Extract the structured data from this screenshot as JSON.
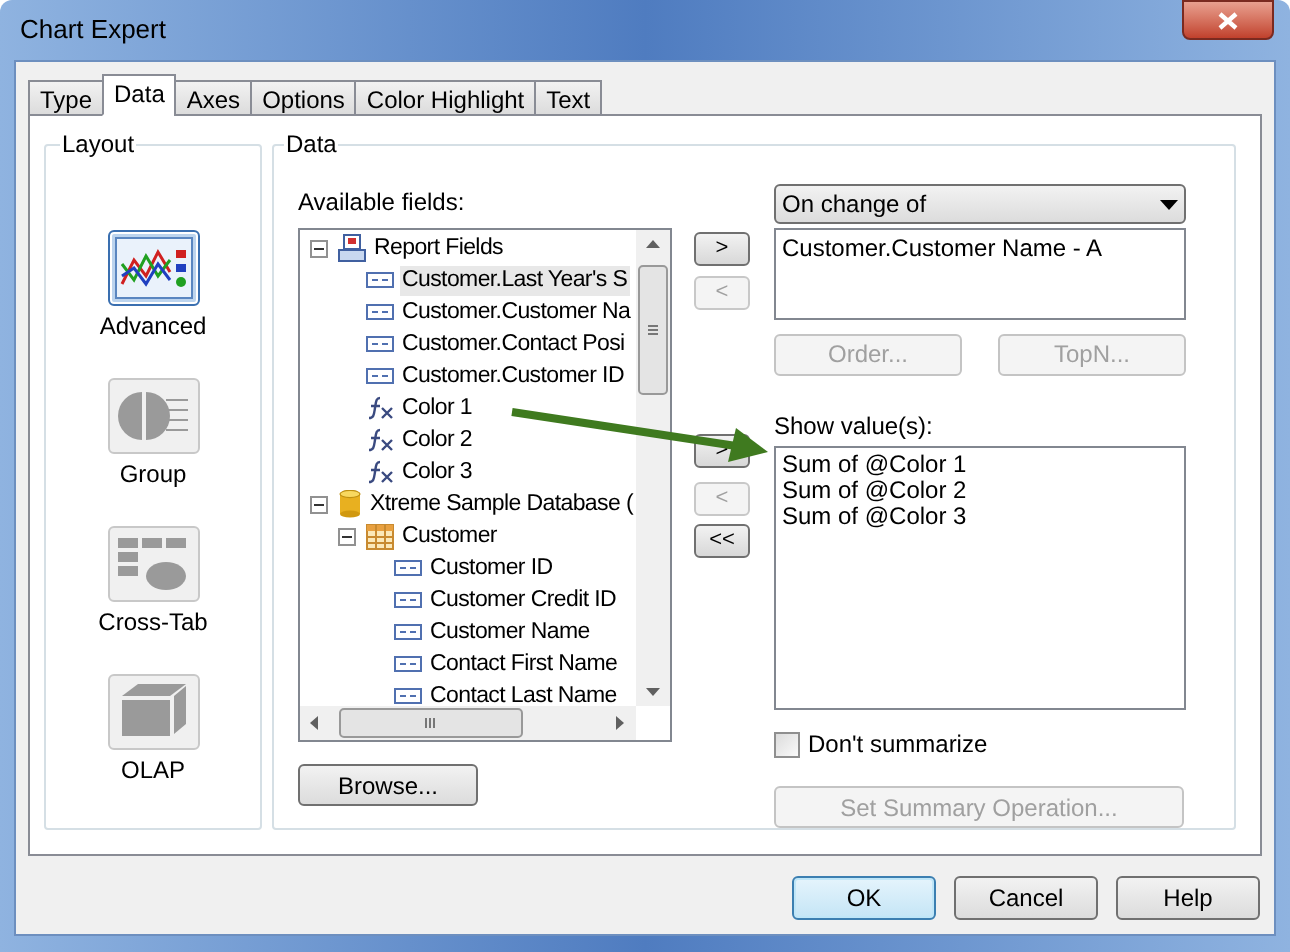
{
  "window": {
    "title": "Chart Expert"
  },
  "tabs": [
    {
      "label": "Type",
      "selected": false
    },
    {
      "label": "Data",
      "selected": true
    },
    {
      "label": "Axes",
      "selected": false
    },
    {
      "label": "Options",
      "selected": false
    },
    {
      "label": "Color Highlight",
      "selected": false
    },
    {
      "label": "Text",
      "selected": false
    }
  ],
  "layout": {
    "title": "Layout",
    "options": [
      {
        "label": "Advanced",
        "kind": "advanced",
        "selected": true
      },
      {
        "label": "Group",
        "kind": "group",
        "selected": false
      },
      {
        "label": "Cross-Tab",
        "kind": "crosstab",
        "selected": false
      },
      {
        "label": "OLAP",
        "kind": "olap",
        "selected": false
      }
    ]
  },
  "data": {
    "title": "Data",
    "available_label": "Available fields:",
    "tree": [
      {
        "label": "Report Fields",
        "kind": "report",
        "expanded": true,
        "selected": false,
        "children": [
          {
            "label": "Customer.Last Year's S",
            "kind": "field",
            "selected": true
          },
          {
            "label": "Customer.Customer Na",
            "kind": "field",
            "selected": false
          },
          {
            "label": "Customer.Contact Posi",
            "kind": "field",
            "selected": false
          },
          {
            "label": "Customer.Customer ID",
            "kind": "field",
            "selected": false
          },
          {
            "label": "Color 1",
            "kind": "formula",
            "selected": false
          },
          {
            "label": "Color 2",
            "kind": "formula",
            "selected": false
          },
          {
            "label": "Color 3",
            "kind": "formula",
            "selected": false
          }
        ]
      },
      {
        "label": "Xtreme Sample Database (",
        "kind": "database",
        "expanded": true,
        "selected": false,
        "children": [
          {
            "label": "Customer",
            "kind": "table",
            "expanded": true,
            "selected": false,
            "children": [
              {
                "label": "Customer ID",
                "kind": "field",
                "selected": false
              },
              {
                "label": "Customer Credit ID",
                "kind": "field",
                "selected": false
              },
              {
                "label": "Customer Name",
                "kind": "field",
                "selected": false
              },
              {
                "label": "Contact First Name",
                "kind": "field",
                "selected": false
              },
              {
                "label": "Contact Last Name",
                "kind": "field",
                "selected": false
              }
            ]
          }
        ]
      }
    ],
    "browse_button": "Browse...",
    "group_buttons": [
      {
        "label": ">",
        "disabled": false
      },
      {
        "label": "<",
        "disabled": true
      }
    ],
    "value_buttons": [
      {
        "label": ">",
        "disabled": false
      },
      {
        "label": "<",
        "disabled": true
      },
      {
        "label": "<<",
        "disabled": false
      }
    ],
    "on_change": {
      "value": "On change of",
      "items": [
        "Customer.Customer Name - A"
      ],
      "buttons": [
        {
          "label": "Order...",
          "disabled": true
        },
        {
          "label": "TopN...",
          "disabled": true
        }
      ]
    },
    "show_values": {
      "label": "Show value(s):",
      "items": [
        "Sum of @Color 1",
        "Sum of @Color 2",
        "Sum of @Color 3"
      ]
    },
    "dont_summarize": {
      "label": "Don't summarize",
      "checked": false
    },
    "summary_button": {
      "label": "Set Summary Operation...",
      "disabled": true
    }
  },
  "buttons": [
    {
      "label": "OK",
      "default": true
    },
    {
      "label": "Cancel",
      "default": false
    },
    {
      "label": "Help",
      "default": false
    }
  ]
}
